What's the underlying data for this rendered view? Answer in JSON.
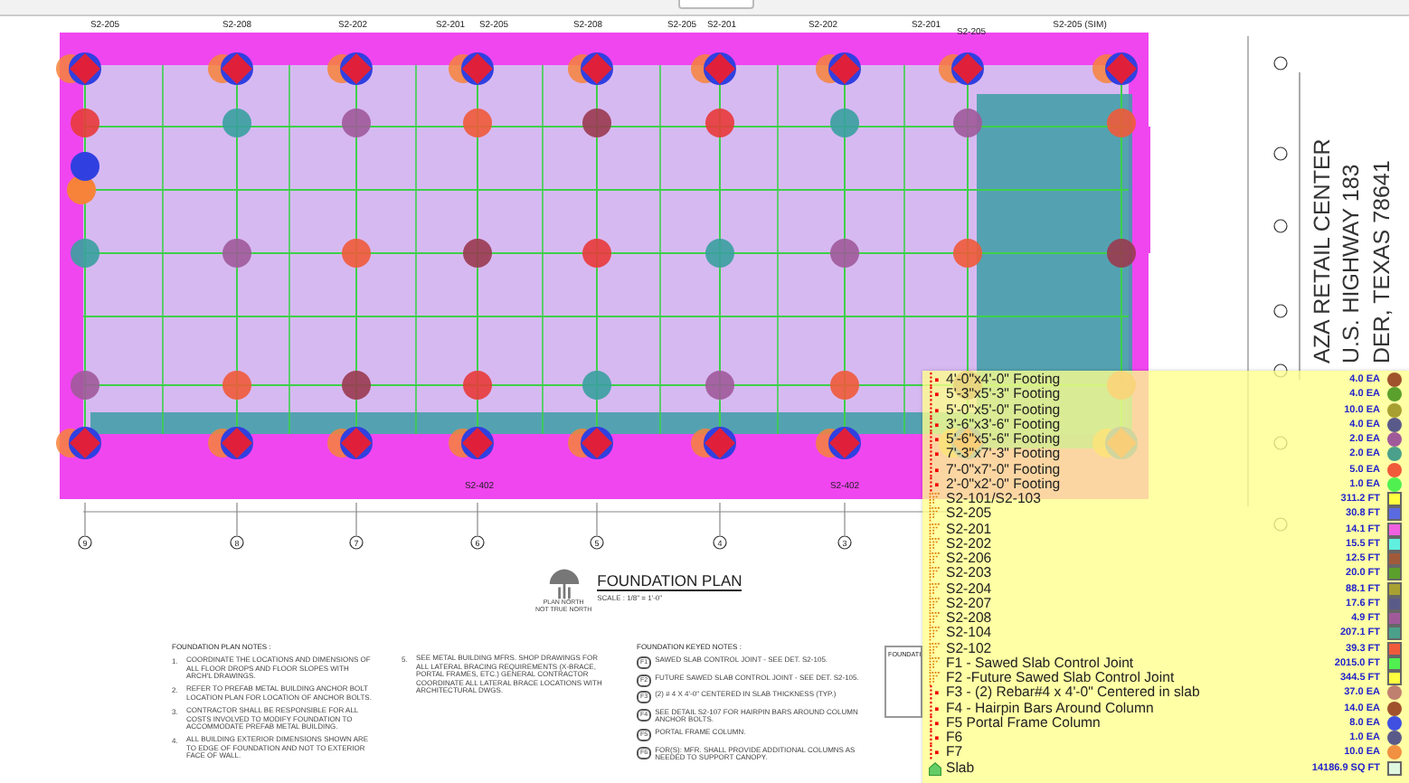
{
  "plan": {
    "top_labels": [
      "S2-205",
      "S2-208",
      "S2-202",
      "S2-201",
      "S2-205",
      "S2-208",
      "S2-205",
      "S2-201",
      "S2-202",
      "S2-201",
      "S2-205",
      "S2-205 (SIM)"
    ],
    "bottom_labels": [
      "S2-402",
      "S2-402"
    ],
    "grid_bubbles": [
      "9",
      "8",
      "7",
      "6",
      "5",
      "4",
      "3"
    ]
  },
  "plan_title": {
    "title": "FOUNDATION PLAN",
    "scale": "SCALE : 1/8\" = 1'-0\"",
    "north": "PLAN NORTH",
    "north_note": "NOT TRUE NORTH"
  },
  "notes": {
    "heading": "FOUNDATION PLAN NOTES :",
    "items": [
      {
        "number": "1.",
        "text": "COORDINATE THE LOCATIONS AND DIMENSIONS OF ALL FLOOR DROPS AND FLOOR SLOPES WITH ARCH'L DRAWINGS."
      },
      {
        "number": "2.",
        "text": "REFER TO PREFAB METAL BUILDING ANCHOR BOLT LOCATION PLAN FOR LOCATION OF ANCHOR BOLTS."
      },
      {
        "number": "3.",
        "text": "CONTRACTOR SHALL BE RESPONSIBLE FOR ALL COSTS INVOLVED TO MODIFY FOUNDATION TO ACCOMMODATE PREFAB METAL BUILDING."
      },
      {
        "number": "4.",
        "text": "ALL BUILDING EXTERIOR DIMENSIONS SHOWN ARE TO EDGE OF FOUNDATION AND NOT TO EXTERIOR FACE OF WALL."
      },
      {
        "number": "5.",
        "text": "SEE METAL BUILDING MFRS. SHOP DRAWINGS FOR ALL LATERAL BRACING REQUIREMENTS (X-BRACE, PORTAL FRAMES, ETC.) GENERAL CONTRACTOR COORDINATE ALL LATERAL BRACE LOCATIONS WITH ARCHITECTURAL DWGS."
      }
    ]
  },
  "keyed_notes": {
    "heading": "FOUNDATION KEYED NOTES :",
    "items": [
      {
        "tag": "F1",
        "text": "SAWED SLAB CONTROL JOINT - SEE DET. S2-105."
      },
      {
        "tag": "F2",
        "text": "FUTURE SAWED SLAB CONTROL JOINT - SEE DET. S2-105."
      },
      {
        "tag": "F3",
        "text": "(2) # 4 X 4'-0\" CENTERED IN SLAB THICKNESS (TYP.)"
      },
      {
        "tag": "F4",
        "text": "SEE DETAIL S2-107 FOR HAIRPIN BARS AROUND COLUMN ANCHOR BOLTS."
      },
      {
        "tag": "F5",
        "text": "PORTAL FRAME COLUMN."
      },
      {
        "tag": "F6",
        "text": "FOR(S): MFR. SHALL PROVIDE ADDITIONAL COLUMNS AS NEEDED TO SUPPORT CANOPY."
      }
    ]
  },
  "side_box": {
    "heading": "FOUNDATI"
  },
  "title_block": {
    "lines": [
      "AZA RETAIL CENTER",
      "U.S. HIGHWAY 183",
      "DER, TEXAS 78641"
    ]
  },
  "legend": {
    "items": [
      {
        "kind": "count",
        "label": "4'-0\"x4'-0\" Footing",
        "quantity": "4.0 EA",
        "color": "#a0522d"
      },
      {
        "kind": "count",
        "label": "5'-3\"x5'-3\" Footing",
        "quantity": "4.0 EA",
        "color": "#5aa02c"
      },
      {
        "kind": "count",
        "label": "5'-0\"x5'-0\" Footing",
        "quantity": "10.0 EA",
        "color": "#a8a030"
      },
      {
        "kind": "count",
        "label": "3'-6\"x3'-6\" Footing",
        "quantity": "4.0 EA",
        "color": "#5a5a8a"
      },
      {
        "kind": "count",
        "label": "5'-6\"x5'-6\" Footing",
        "quantity": "2.0 EA",
        "color": "#a05a9a"
      },
      {
        "kind": "count",
        "label": "7'-3\"x7'-3\" Footing",
        "quantity": "2.0 EA",
        "color": "#4aa08a"
      },
      {
        "kind": "count",
        "label": "7'-0\"x7'-0\" Footing",
        "quantity": "5.0 EA",
        "color": "#f05a3a"
      },
      {
        "kind": "count",
        "label": "2'-0\"x2'-0\" Footing",
        "quantity": "1.0 EA",
        "color": "#50f050"
      },
      {
        "kind": "linear",
        "label": "S2-101/S2-103",
        "quantity": "311.2 FT",
        "color": "#ffff40"
      },
      {
        "kind": "linear",
        "label": "S2-205",
        "quantity": "30.8 FT",
        "color": "#5a6ae0"
      },
      {
        "kind": "linear",
        "label": "S2-201",
        "quantity": "14.1 FT",
        "color": "#f060e0"
      },
      {
        "kind": "linear",
        "label": "S2-202",
        "quantity": "15.5 FT",
        "color": "#60f0e0"
      },
      {
        "kind": "linear",
        "label": "S2-206",
        "quantity": "12.5 FT",
        "color": "#a05a3a"
      },
      {
        "kind": "linear",
        "label": "S2-203",
        "quantity": "20.0 FT",
        "color": "#5aa02c"
      },
      {
        "kind": "linear",
        "label": "S2-204",
        "quantity": "88.1 FT",
        "color": "#a8a030"
      },
      {
        "kind": "linear",
        "label": "S2-207",
        "quantity": "17.6 FT",
        "color": "#5a5a8a"
      },
      {
        "kind": "linear",
        "label": "S2-208",
        "quantity": "4.9 FT",
        "color": "#a05a9a"
      },
      {
        "kind": "linear",
        "label": "S2-104",
        "quantity": "207.1 FT",
        "color": "#4aa08a"
      },
      {
        "kind": "linear",
        "label": "S2-102",
        "quantity": "39.3 FT",
        "color": "#f05a3a"
      },
      {
        "kind": "linear",
        "label": "F1 - Sawed Slab Control Joint",
        "quantity": "2015.0 FT",
        "color": "#50f050"
      },
      {
        "kind": "linear",
        "label": "F2 -Future Sawed Slab Control Joint",
        "quantity": "344.5 FT",
        "color": "#ffff40"
      },
      {
        "kind": "count",
        "label": "F3 - (2) Rebar#4 x 4'-0\" Centered in slab",
        "quantity": "37.0 EA",
        "color": "#c08070"
      },
      {
        "kind": "count",
        "label": "F4 - Hairpin Bars Around Column",
        "quantity": "14.0 EA",
        "color": "#a0522d"
      },
      {
        "kind": "count",
        "label": "F5 Portal Frame Column",
        "quantity": "8.0 EA",
        "color": "#4050e0"
      },
      {
        "kind": "count",
        "label": "F6",
        "quantity": "1.0 EA",
        "color": "#5a5a8a"
      },
      {
        "kind": "count",
        "label": "F7",
        "quantity": "10.0 EA",
        "color": "#f09040"
      },
      {
        "kind": "area",
        "label": "Slab",
        "quantity": "14186.9 SQ FT",
        "color": "#e0f8e0"
      }
    ]
  }
}
